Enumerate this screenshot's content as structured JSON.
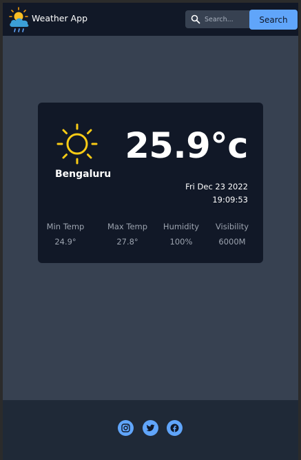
{
  "header": {
    "app_title": "Weather App",
    "logo_icon": "cloud-sun-rain-icon",
    "search": {
      "placeholder": "Search...",
      "value": "",
      "button_label": "Search"
    }
  },
  "weather": {
    "icon": "sun-icon",
    "city": "Bengaluru",
    "temperature": "25.9°c",
    "date": "Fri Dec 23 2022",
    "time": "19:09:53",
    "stats": [
      {
        "label": "Min Temp",
        "value": "24.9°"
      },
      {
        "label": "Max Temp",
        "value": "27.8°"
      },
      {
        "label": "Humidity",
        "value": "100%"
      },
      {
        "label": "Visibility",
        "value": "6000M"
      }
    ]
  },
  "footer": {
    "social": [
      {
        "icon": "instagram-icon"
      },
      {
        "icon": "twitter-icon"
      },
      {
        "icon": "facebook-icon"
      }
    ]
  },
  "colors": {
    "navbar": "#111827",
    "page_background": "#374151",
    "card": "#111827",
    "footer": "#1f2937",
    "accent": "#60a5fa",
    "sun": "#facc15"
  }
}
